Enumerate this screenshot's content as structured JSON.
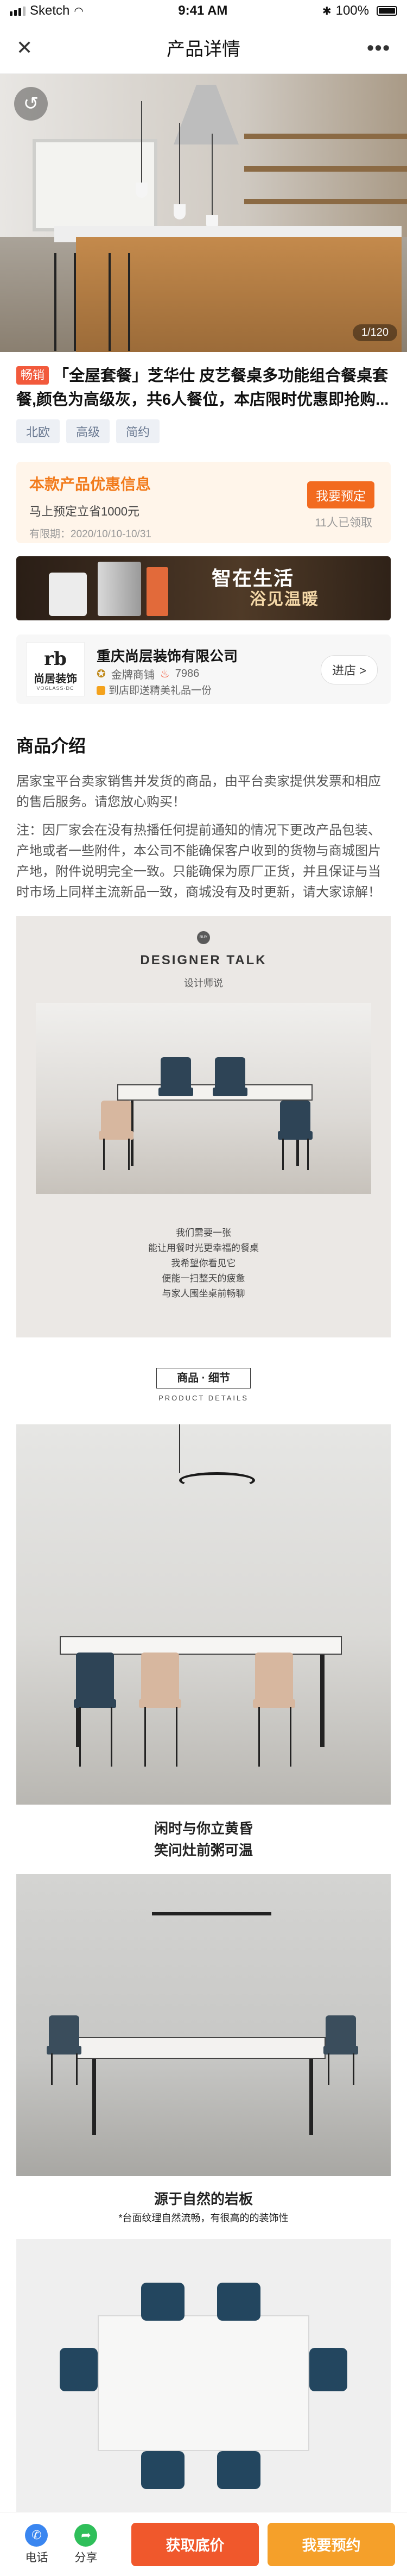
{
  "status_bar": {
    "carrier": "Sketch",
    "time": "9:41 AM",
    "battery": "100%"
  },
  "nav": {
    "title": "产品详情",
    "close_icon": "close-icon",
    "more_icon": "more-icon"
  },
  "hero": {
    "counter": "1/120"
  },
  "product": {
    "tag": "畅销",
    "title": "「全屋套餐」芝华仕 皮艺餐桌多功能组合餐桌套餐,颜色为高级灰，共6人餐位，本店限时优惠即抢购...",
    "chips": [
      "北欧",
      "高级",
      "简约"
    ]
  },
  "promo": {
    "title": "本款产品优惠信息",
    "desc": "马上预定立省1000元",
    "date": "有限期：2020/10/10-10/31",
    "button": "我要预定",
    "count": "11人已领取"
  },
  "banner": {
    "line1": "智在生活",
    "line2": "浴见温暖"
  },
  "store": {
    "logo_cn": "尚居装饰",
    "logo_en": "VOGLASS·DC",
    "name": "重庆尚层装饰有限公司",
    "level": "金牌商铺",
    "hot": "7986",
    "gift": "到店即送精美礼品一份",
    "enter": "进店 >"
  },
  "intro": {
    "title": "商品介绍",
    "p1": "居家宝平台卖家销售并发货的商品，由平台卖家提供发票和相应的售后服务。请您放心购买！",
    "p2": "注：因厂家会在没有热播任何提前通知的情况下更改产品包装、产地或者一些附件，本公司不能确保客户收到的货物与商城图片产地，附件说明完全一致。只能确保为原厂正货，并且保证与当时市场上同样主流新品一致，商城没有及时更新，请大家谅解！"
  },
  "designer": {
    "badge": "BUY",
    "title": "DESIGNER TALK",
    "subtitle": "设计师说",
    "lines": [
      "我们需要一张",
      "能让用餐时光更幸福的餐桌",
      "我希望你看见它",
      "便能一扫整天的疲惫",
      "与家人围坐桌前畅聊"
    ]
  },
  "details_header": {
    "title": "商品 · 细节",
    "en": "PRODUCT DETAILS"
  },
  "caption1": {
    "line1": "闲时与你立黄昏",
    "line2": "笑问灶前粥可温"
  },
  "caption2": {
    "line1": "源于自然的岩板",
    "line2": "*台面纹理自然流畅，有很高的的装饰性"
  },
  "bottom": {
    "phone_label": "电话",
    "share_label": "分享",
    "btn_price": "获取底价",
    "btn_book": "我要预约"
  },
  "colors": {
    "accent": "#f0582c",
    "orange": "#f5a02a",
    "tag": "#f25a3c",
    "phone": "#3a86f0",
    "share": "#2fbf5a"
  }
}
